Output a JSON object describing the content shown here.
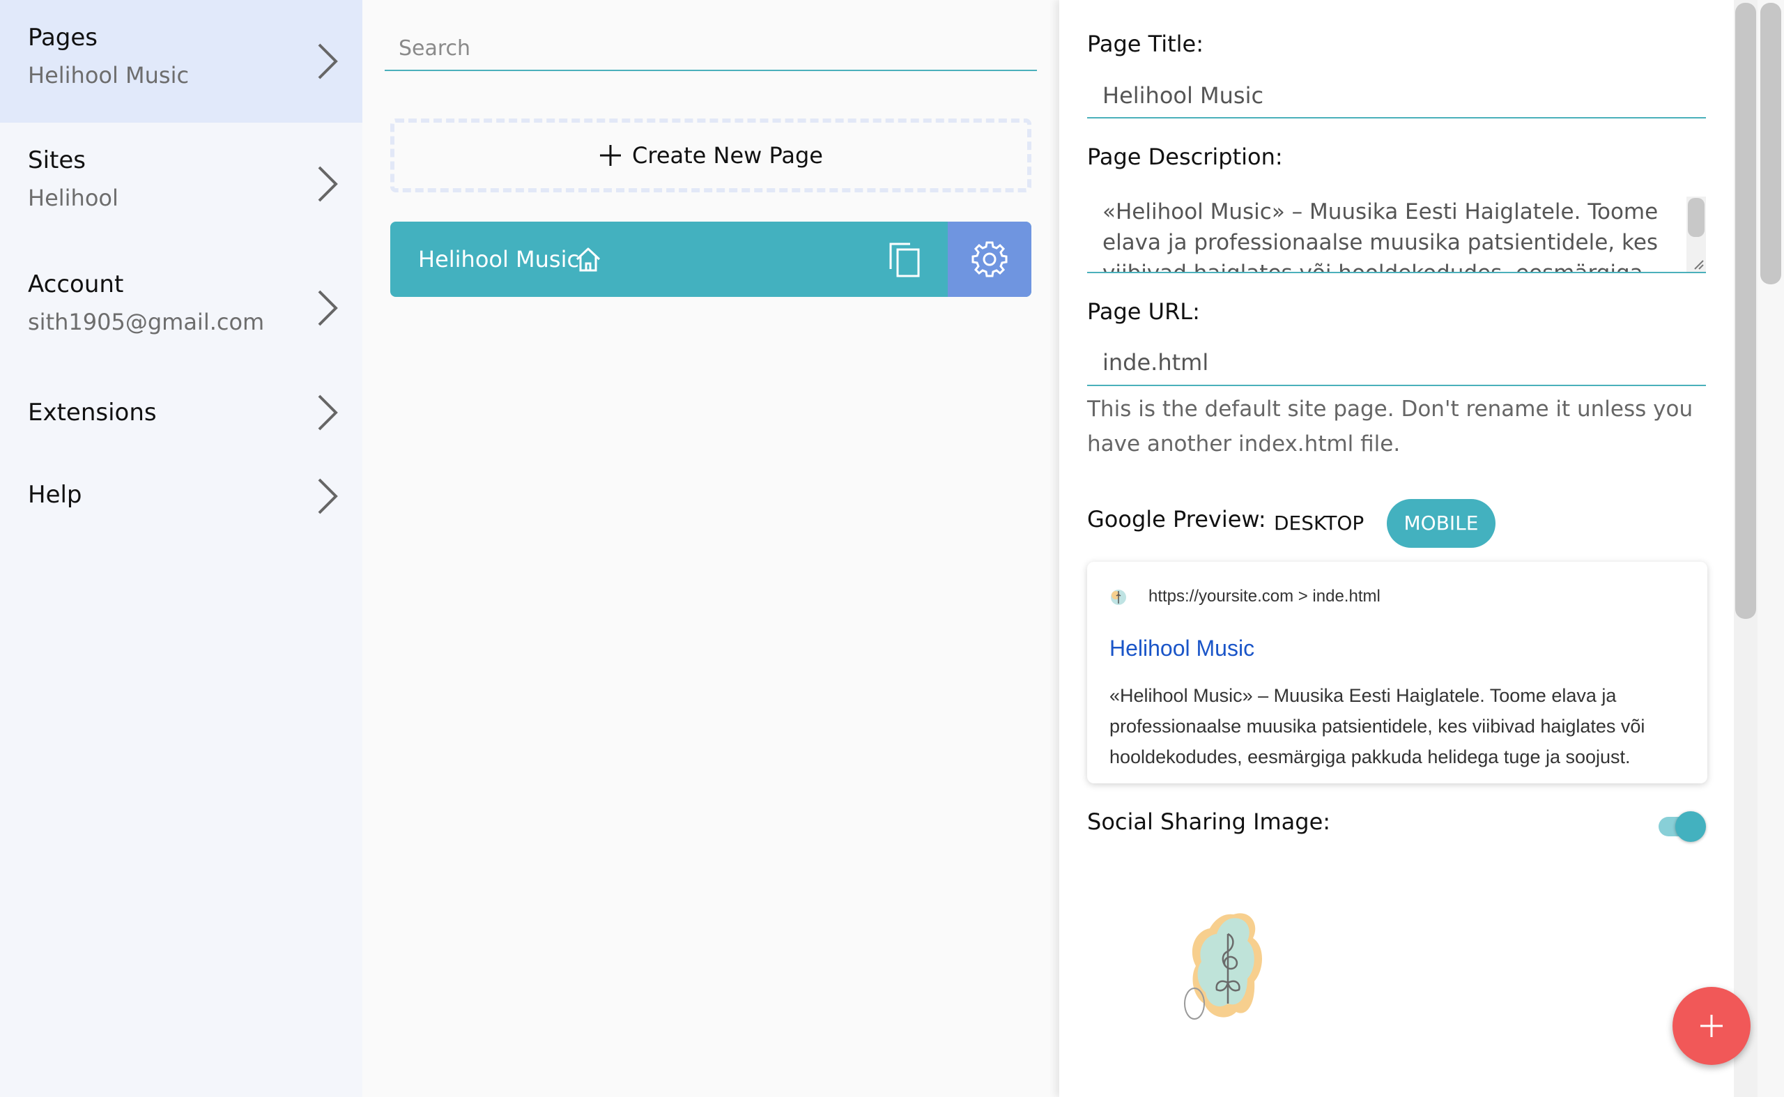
{
  "sidebar": {
    "items": [
      {
        "title": "Pages",
        "subtitle": "Helihool Music"
      },
      {
        "title": "Sites",
        "subtitle": "Helihool"
      },
      {
        "title": "Account",
        "subtitle": "sith1905@gmail.com"
      },
      {
        "title": "Extensions"
      },
      {
        "title": "Help"
      }
    ]
  },
  "pages_panel": {
    "search_placeholder": "Search",
    "create_label": "Create New Page",
    "pages": [
      {
        "label": "Helihool Music"
      }
    ]
  },
  "settings": {
    "title_label": "Page Title:",
    "title_value": "Helihool Music",
    "description_label": "Page Description:",
    "description_value": "«Helihool Music» – Muusika Eesti Haiglatele. Toome elava ja professionaalse muusika patsientidele, kes viibivad haiglates või hooldekodudes, eesmärgiga pakkuda helidega tuge ja soojust.",
    "url_label": "Page URL:",
    "url_value": "inde.html",
    "url_help": "This is the default site page. Don't rename it unless you have another index.html file.",
    "google_preview_label": "Google Preview:",
    "desktop_label": "DESKTOP",
    "mobile_label": "MOBILE",
    "preview": {
      "url": "https://yoursite.com > inde.html",
      "title": "Helihool Music",
      "description": "«Helihool Music» – Muusika Eesti Haiglatele. Toome elava ja professionaalse muusika patsientidele, kes viibivad haiglates või hooldekodudes, eesmärgiga pakkuda helidega tuge ja soojust."
    },
    "social_label": "Social Sharing Image:",
    "social_enabled": true
  },
  "colors": {
    "accent": "#43b1bf",
    "settings_button": "#6f95e0",
    "fab": "#f15858",
    "link": "#1a55c8"
  },
  "icons": [
    "chevron-right-icon",
    "plus-icon",
    "home-icon",
    "copy-icon",
    "gear-icon",
    "favicon-icon",
    "plus-icon"
  ]
}
